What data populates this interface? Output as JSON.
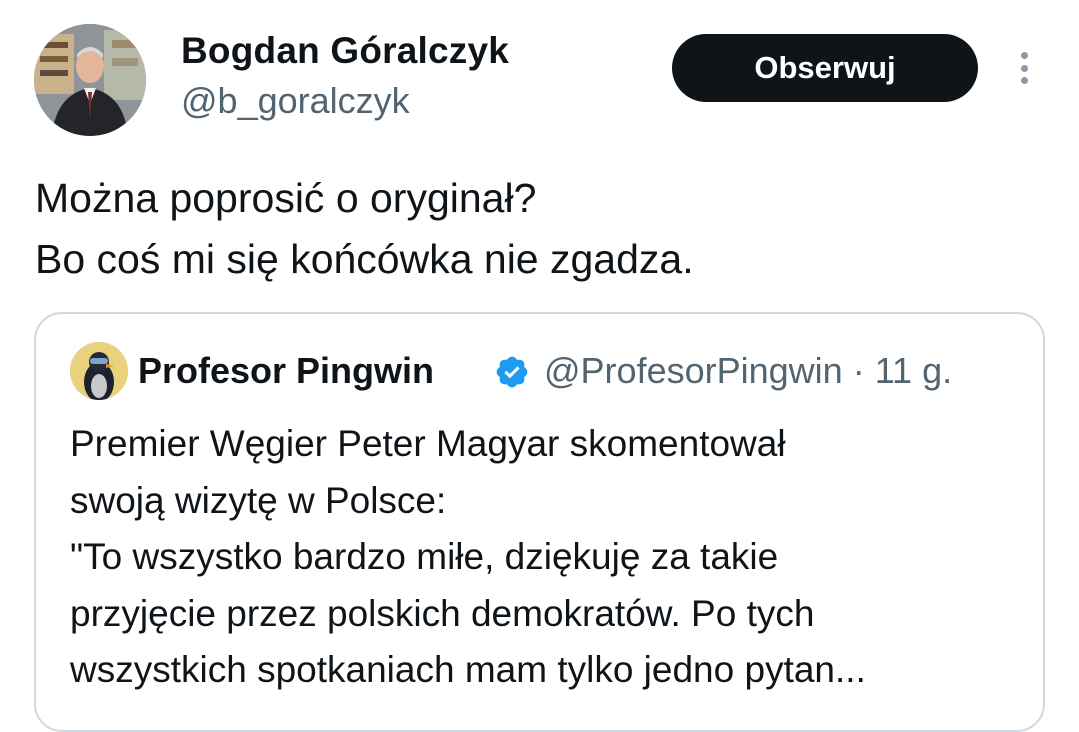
{
  "author": {
    "name": "Bogdan Góralczyk",
    "handle": "@b_goralczyk"
  },
  "actions": {
    "follow_label": "Obserwuj"
  },
  "tweet": {
    "lines": [
      "Można poprosić o oryginał?",
      "Bo coś mi się końcówka nie zgadza."
    ]
  },
  "quoted_tweet": {
    "name": "Profesor Pingwin",
    "handle": "@ProfesorPingwin",
    "separator": "·",
    "time": "11 g.",
    "lines": [
      "Premier Węgier Peter Magyar skomentował",
      "swoją wizytę w Polsce:",
      "\"To wszystko bardzo miłe, dziękuję za takie",
      "przyjęcie przez polskich demokratów. Po tych",
      "wszystkich spotkaniach mam tylko jedno pytan..."
    ]
  },
  "icons": {
    "verified": "verified-badge-icon",
    "more": "more-vertical-icon"
  },
  "colors": {
    "follow_bg": "#0f1419",
    "secondary_text": "#536471",
    "verified": "#1d9bf0",
    "card_border": "#cfd9de"
  }
}
